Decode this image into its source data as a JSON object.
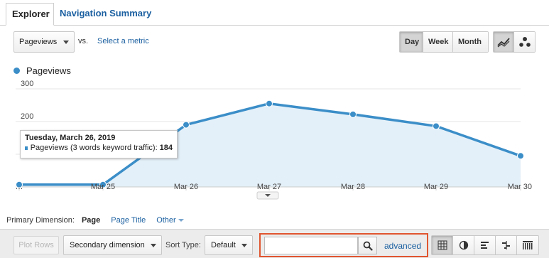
{
  "tabs": [
    {
      "label": "Explorer",
      "active": true
    },
    {
      "label": "Navigation Summary",
      "active": false
    }
  ],
  "metric": {
    "selected": "Pageviews",
    "vs_label": "vs.",
    "select_metric_link": "Select a metric"
  },
  "granularity": {
    "options": [
      "Day",
      "Week",
      "Month"
    ],
    "active": "Day"
  },
  "chart_type_buttons": [
    {
      "icon": "line-chart-icon",
      "active": true
    },
    {
      "icon": "motion-chart-icon",
      "active": false
    }
  ],
  "legend": {
    "label": "Pageviews",
    "color": "#3b8ec8"
  },
  "chart_data": {
    "type": "area",
    "series": [
      {
        "name": "Pageviews",
        "values": [
          7,
          7,
          190,
          255,
          222,
          186,
          95
        ]
      }
    ],
    "x": [
      "…",
      "Mar 25",
      "Mar 26",
      "Mar 27",
      "Mar 28",
      "Mar 29",
      "Mar 30"
    ],
    "y_ticks": [
      "300",
      "200"
    ],
    "ylim": [
      0,
      300
    ],
    "grid": true,
    "line_color": "#3b8ec8",
    "fill_color": "#e4f0f9"
  },
  "tooltip": {
    "title": "Tuesday, March 26, 2019",
    "series_label": "Pageviews (3 words keyword traffic):",
    "value": "184"
  },
  "primary_dimension": {
    "label": "Primary Dimension:",
    "options": [
      "Page",
      "Page Title",
      "Other"
    ],
    "active": "Page"
  },
  "toolbar": {
    "plot_rows": "Plot Rows",
    "secondary_dimension": "Secondary dimension",
    "sort_type_label": "Sort Type:",
    "sort_type_value": "Default",
    "search_value": "",
    "advanced_link": "advanced",
    "highlight_color": "#e0552f",
    "view_buttons": [
      "table-view-icon",
      "pie-view-icon",
      "performance-view-icon",
      "comparison-view-icon",
      "pivot-view-icon"
    ]
  }
}
